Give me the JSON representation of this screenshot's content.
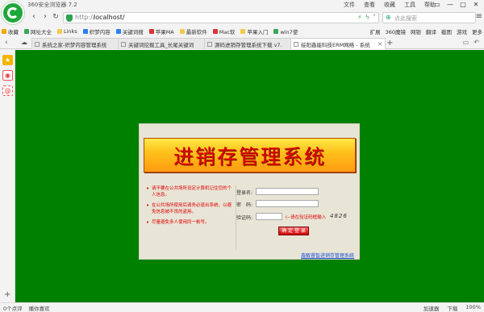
{
  "titlebar": {
    "app_title": "360安全浏览器 7.2",
    "menu": [
      "文件",
      "查看",
      "收藏",
      "工具",
      "帮助"
    ],
    "window_buttons": [
      "▭",
      "—",
      "□",
      "✕"
    ]
  },
  "navbar": {
    "url_prefix": "http://",
    "url": "localhost/",
    "search_placeholder": "点此搜索"
  },
  "bookmarks": {
    "items": [
      {
        "label": "收藏",
        "color": "#f2a900"
      },
      {
        "label": "网址大全",
        "color": "#3aa757"
      },
      {
        "label": "Links",
        "color": "#f2c94c"
      },
      {
        "label": "织梦内容",
        "color": "#2d7ff9"
      },
      {
        "label": "关键词搜",
        "color": "#2d7ff9"
      },
      {
        "label": "苹果MA",
        "color": "#d33"
      },
      {
        "label": "最新软件",
        "color": "#f2c94c"
      },
      {
        "label": "Mac软",
        "color": "#d33"
      },
      {
        "label": "苹果入门",
        "color": "#f2c94c"
      },
      {
        "label": "win7使",
        "color": "#3aa757"
      }
    ],
    "right": [
      "扩展",
      "360魔镜",
      "网银",
      "翻译",
      "截图",
      "游戏",
      "更多"
    ]
  },
  "tabs": [
    {
      "label": "系统之家-织梦内容管理系统"
    },
    {
      "label": "关键词挖掘工具_长尾关键词"
    },
    {
      "label": "源码进销存管理系统下载 v7."
    },
    {
      "label": "绥阳鑫能科技ERM网络 - 系统"
    }
  ],
  "login": {
    "banner": "进销存管理系统",
    "notes": [
      "请不要在公共场所设定计算机记住您的个人信息。",
      "在公共场所使用后请务必退出系统，以避免信息被不良的盗用。",
      "尽量避免多人使用同一帐号。"
    ],
    "username_label": "登录名:",
    "password_label": "密　码:",
    "captcha_label": "验证码:",
    "captcha_hint": "(--请在验证码框输入",
    "captcha_value": "4826",
    "submit_label": "确 定 登 录",
    "footer_link": "鑫敏睿智进销存管理系统"
  },
  "statusbar": {
    "left": [
      "0个点评",
      "播你喜欢"
    ],
    "right": [
      "加速器",
      "下载",
      "100%"
    ]
  }
}
